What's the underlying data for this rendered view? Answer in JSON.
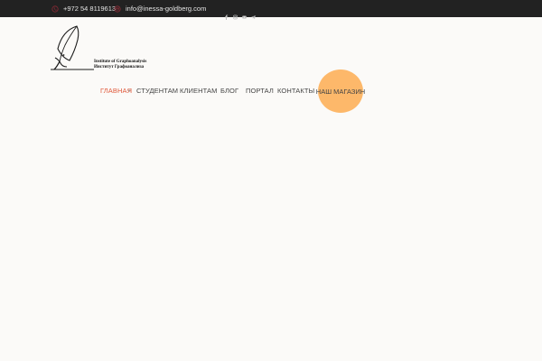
{
  "topbar": {
    "phone": {
      "icon": "phone-icon",
      "text": "+972 54 8119613"
    },
    "email": {
      "icon": "email-icon",
      "text": "info@inessa-goldberg.com"
    },
    "social": [
      "facebook-icon",
      "instagram-icon",
      "youtube-icon",
      "telegram-icon"
    ]
  },
  "logo": {
    "line1": "Institute of Graphoanalysis",
    "line2": "Институт Графоанализа"
  },
  "nav": {
    "items": [
      {
        "label": "ГЛАВНАЯ",
        "active": true
      },
      {
        "label": "СТУДЕНТАМ"
      },
      {
        "label": "КЛИЕНТАМ"
      },
      {
        "label": "БЛОГ"
      },
      {
        "label": "ПОРТАЛ"
      },
      {
        "label": "КОНТАКТЫ"
      }
    ],
    "shop_label": "НАШ МАГАЗИН"
  },
  "colors": {
    "topbar_bg": "#222222",
    "accent_active": "#e15a3c",
    "shop_bg": "#fdb86a",
    "icon_accent": "#8a2a35"
  }
}
